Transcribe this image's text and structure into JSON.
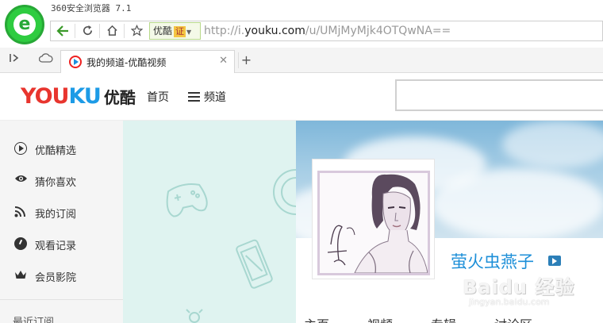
{
  "browser": {
    "window_title": "360安全浏览器 7.1",
    "cert_label": "优酷",
    "cert_badge": "证",
    "url_prefix": "http://i.",
    "url_domain": "youku.com",
    "url_path": "/u/UMjMyMjk4OTQwNA==",
    "tab_title": "我的频道-优酷视频"
  },
  "youku": {
    "logo_you": "YOU",
    "logo_ku": "KU",
    "logo_cn": "优酷",
    "nav_home": "首页",
    "nav_channel": "频道"
  },
  "sidebar": {
    "items": [
      {
        "label": "优酷精选",
        "icon": "play-circle-icon"
      },
      {
        "label": "猜你喜欢",
        "icon": "eye-icon"
      },
      {
        "label": "我的订阅",
        "icon": "rss-icon"
      },
      {
        "label": "观看记录",
        "icon": "clock-icon"
      },
      {
        "label": "会员影院",
        "icon": "crown-icon"
      }
    ],
    "section_title": "最近订阅"
  },
  "profile": {
    "username": "萤火虫燕子",
    "tabs": [
      "主页",
      "视频",
      "专辑",
      "讨论区"
    ]
  },
  "watermark": {
    "brand": "Baidu 经验",
    "url": "jingyan.baidu.com"
  },
  "colors": {
    "youku_red": "#e8352e",
    "youku_blue": "#1d9be6",
    "browser_green": "#2ecc40",
    "sidebar_bg": "#f5f5f5",
    "deco_bg": "#dff3f0"
  }
}
